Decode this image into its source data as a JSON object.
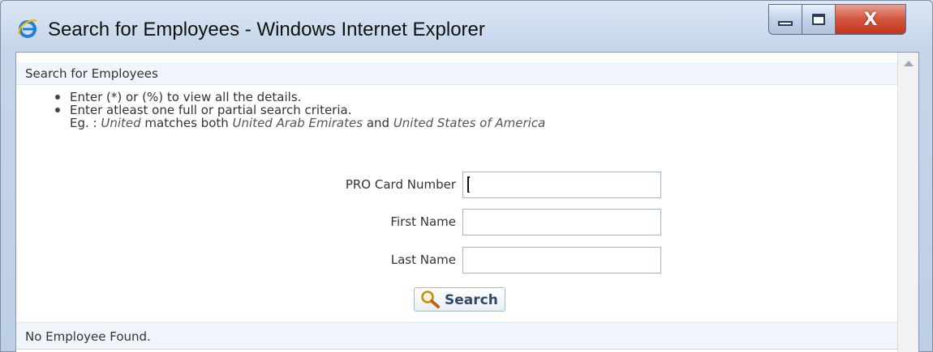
{
  "window": {
    "title": "Search for Employees - Windows Internet Explorer",
    "buttons": {
      "close_label": "X"
    }
  },
  "page": {
    "header": "Search for Employees",
    "instructions": [
      "Enter (*) or (%) to view all the details.",
      "Enter atleast one full or partial search criteria."
    ],
    "example": {
      "prefix": "Eg. : ",
      "term": "United",
      "middle": " matches both ",
      "match1": "United Arab Emirates",
      "conjunction": " and ",
      "match2": "United States of America"
    },
    "form": {
      "pro_card_label": "PRO Card Number",
      "pro_card_value": "",
      "first_name_label": "First Name",
      "first_name_value": "",
      "last_name_label": "Last Name",
      "last_name_value": ""
    },
    "search_button_label": "Search",
    "status": "No Employee Found."
  },
  "icons": {
    "browser": "internet-explorer-icon",
    "search": "magnifier-icon"
  },
  "colors": {
    "header_bg": "#f0f5fb",
    "close_button": "#d3543c",
    "search_label": "#2c4a6e"
  }
}
